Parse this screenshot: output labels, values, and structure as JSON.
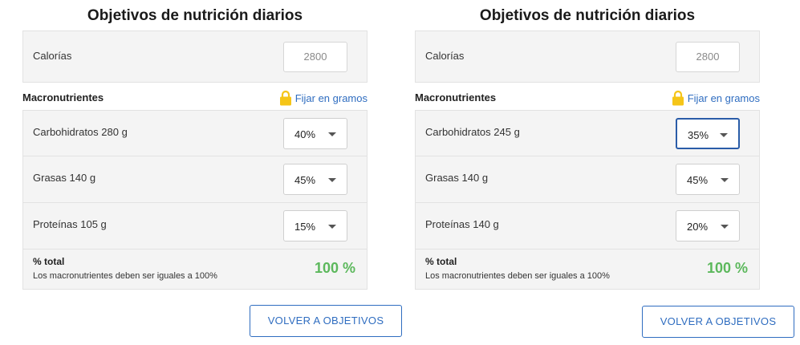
{
  "panels": [
    {
      "title": "Objetivos de nutrición diarios",
      "calories": {
        "label": "Calorías",
        "value": "2800"
      },
      "macros_title": "Macronutrientes",
      "lock_link": "Fijar en gramos",
      "macros": [
        {
          "label": "Carbohidratos 280 g",
          "percent": "40%"
        },
        {
          "label": "Grasas 140 g",
          "percent": "45%"
        },
        {
          "label": "Proteínas 105 g",
          "percent": "15%"
        }
      ],
      "total": {
        "title": "% total",
        "note": "Los macronutrientes deben ser iguales a 100%",
        "value": "100 %"
      },
      "back_button": "VOLVER A OBJETIVOS"
    },
    {
      "title": "Objetivos de nutrición diarios",
      "calories": {
        "label": "Calorías",
        "value": "2800"
      },
      "macros_title": "Macronutrientes",
      "lock_link": "Fijar en gramos",
      "macros": [
        {
          "label": "Carbohidratos 245 g",
          "percent": "35%"
        },
        {
          "label": "Grasas 140 g",
          "percent": "45%"
        },
        {
          "label": "Proteínas 140 g",
          "percent": "20%"
        }
      ],
      "total": {
        "title": "% total",
        "note": "Los macronutrientes deben ser iguales a 100%",
        "value": "100 %"
      },
      "back_button": "VOLVER A OBJETIVOS"
    }
  ],
  "colors": {
    "link": "#2f6dc0",
    "total_ok": "#5cb85c",
    "lock": "#f5c518",
    "focus": "#2a5ca8"
  },
  "icons": {
    "lock": "lock-icon",
    "dropdown": "chevron-down-icon"
  }
}
